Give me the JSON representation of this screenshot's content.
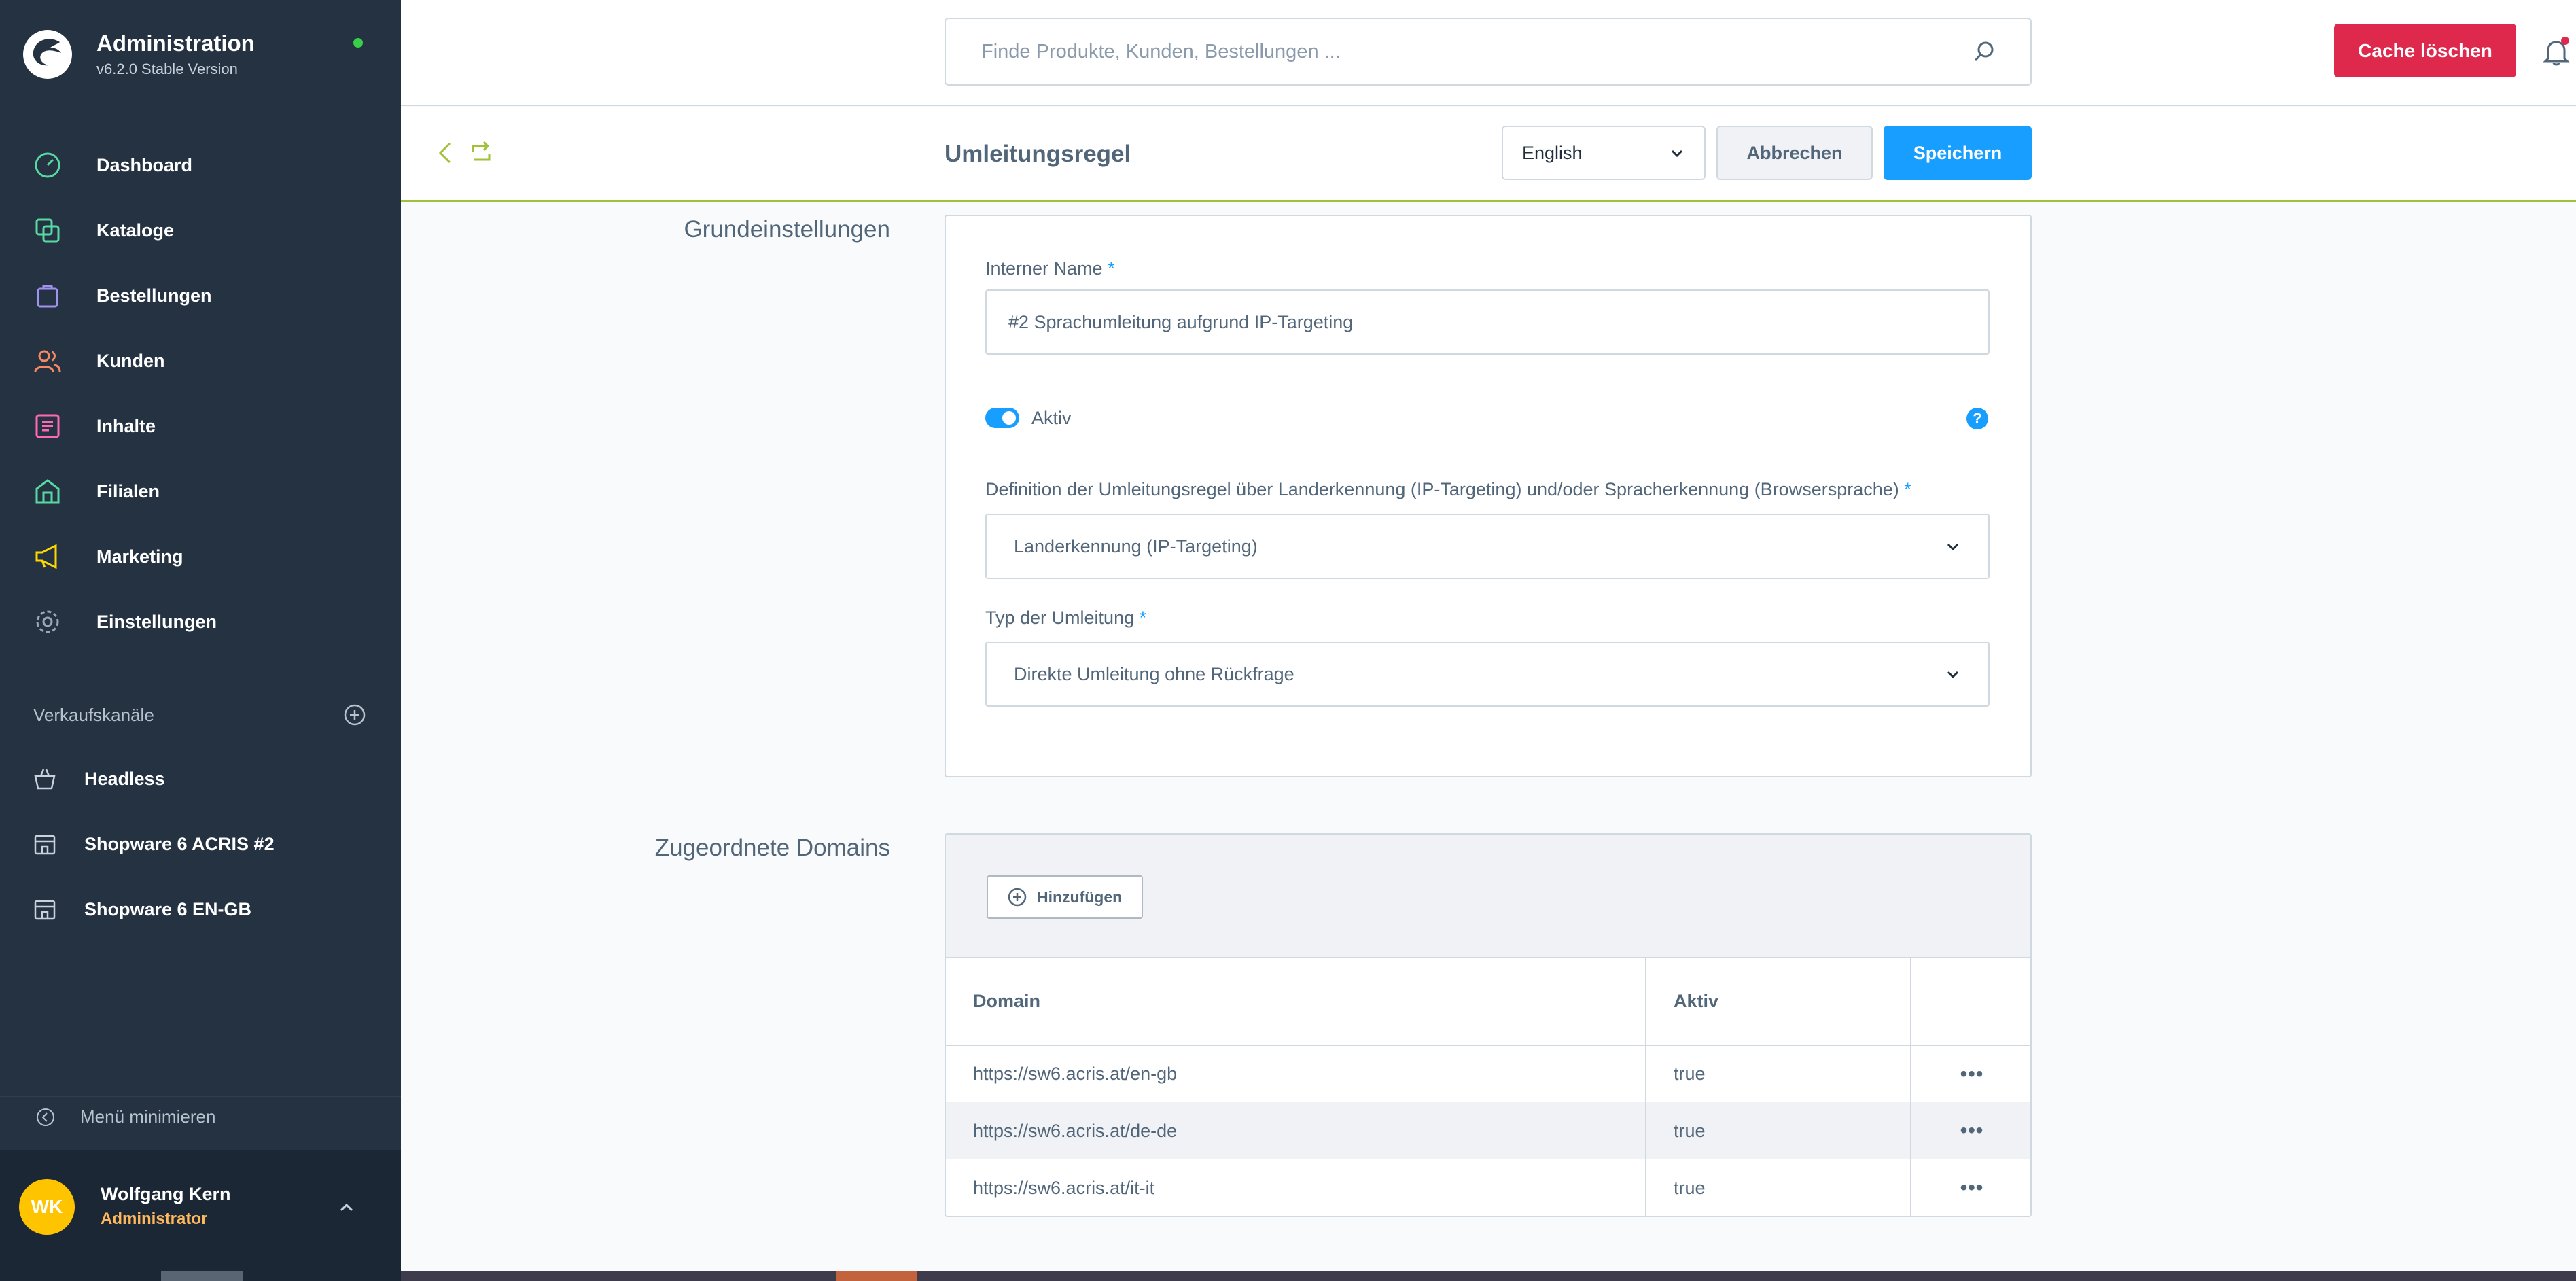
{
  "brand": {
    "title": "Administration",
    "version": "v6.2.0 Stable Version"
  },
  "nav": [
    {
      "label": "Dashboard",
      "icon": "dashboard-icon",
      "color": "#57d9a3"
    },
    {
      "label": "Kataloge",
      "icon": "catalog-icon",
      "color": "#57d9a3"
    },
    {
      "label": "Bestellungen",
      "icon": "shopping-bag-icon",
      "color": "#a092f0"
    },
    {
      "label": "Kunden",
      "icon": "customers-icon",
      "color": "#f88962"
    },
    {
      "label": "Inhalte",
      "icon": "content-icon",
      "color": "#ff68b4"
    },
    {
      "label": "Filialen",
      "icon": "stores-icon",
      "color": "#57d9a3"
    },
    {
      "label": "Marketing",
      "icon": "megaphone-icon",
      "color": "#ffd700"
    },
    {
      "label": "Einstellungen",
      "icon": "gear-icon",
      "color": "#9aa8b5"
    }
  ],
  "sales_channels": {
    "title": "Verkaufskanäle",
    "items": [
      {
        "label": "Headless"
      },
      {
        "label": "Shopware 6 ACRIS #2"
      },
      {
        "label": "Shopware 6 EN-GB"
      }
    ]
  },
  "minimize_label": "Menü minimieren",
  "user": {
    "initials": "WK",
    "name": "Wolfgang Kern",
    "role": "Administrator"
  },
  "search": {
    "placeholder": "Finde Produkte, Kunden, Bestellungen ..."
  },
  "cache_button": "Cache löschen",
  "page_title": "Umleitungsregel",
  "language": "English",
  "cancel_label": "Abbrechen",
  "save_label": "Speichern",
  "basic_section": {
    "title": "Grundeinstellungen",
    "internal_name_label": "Interner Name",
    "internal_name_value": "#2 Sprachumleitung aufgrund IP-Targeting",
    "active_label": "Aktiv",
    "active": true,
    "definition_label": "Definition der Umleitungsregel über Landerkennung (IP-Targeting) und/oder Spracherkennung (Browsersprache)",
    "definition_value": "Landerkennung (IP-Targeting)",
    "type_label": "Typ der Umleitung",
    "type_value": "Direkte Umleitung ohne Rückfrage",
    "required_mark": "*",
    "help_mark": "?"
  },
  "domains_section": {
    "title": "Zugeordnete Domains",
    "add_label": "Hinzufügen",
    "columns": [
      "Domain",
      "Aktiv",
      ""
    ],
    "rows": [
      {
        "domain": "https://sw6.acris.at/en-gb",
        "active": "true"
      },
      {
        "domain": "https://sw6.acris.at/de-de",
        "active": "true"
      },
      {
        "domain": "https://sw6.acris.at/it-it",
        "active": "true"
      }
    ],
    "actions_glyph": "•••"
  },
  "colors": {
    "primary": "#189eff",
    "danger": "#de294c",
    "sidebar": "#243242",
    "accent_line": "#a2c13a"
  }
}
